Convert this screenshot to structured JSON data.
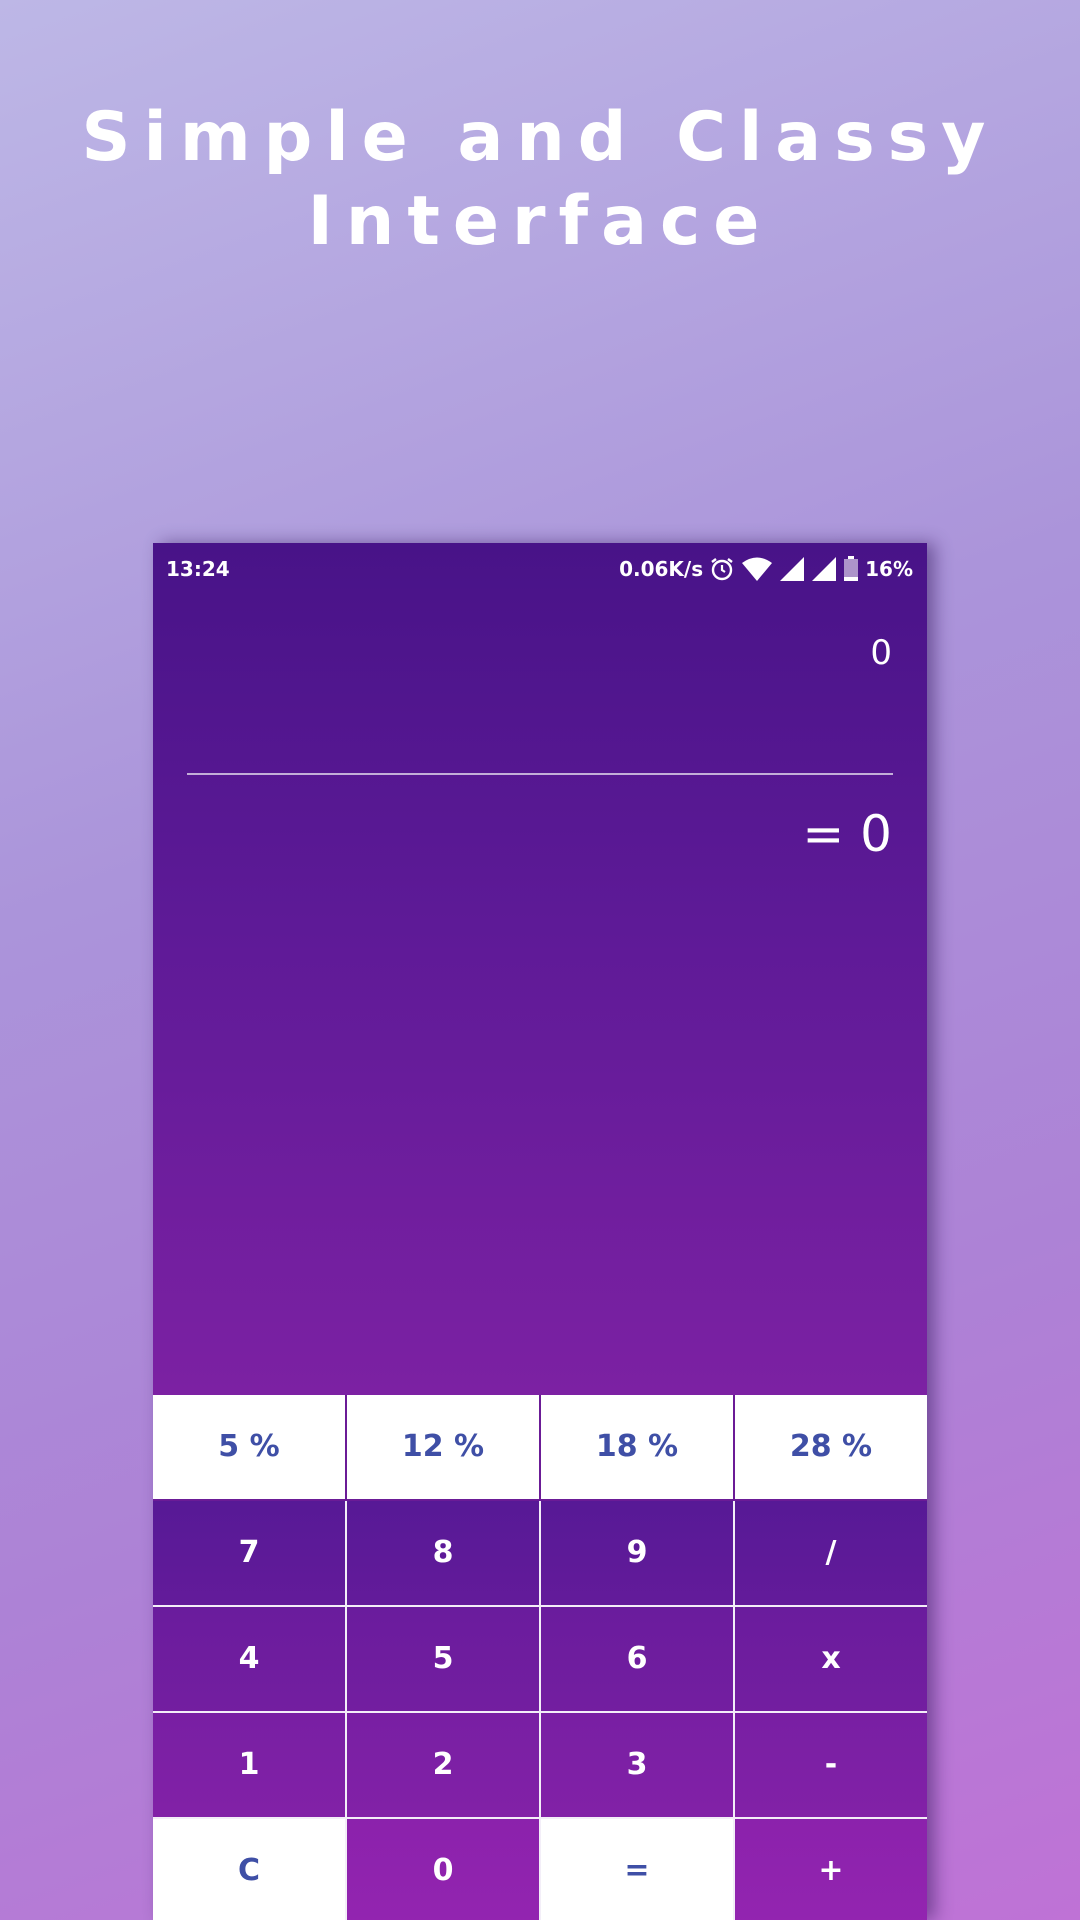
{
  "banner": {
    "line1": "Simple and Classy",
    "line2": "Interface"
  },
  "status_bar": {
    "time": "13:24",
    "net_speed": "0.06K/s",
    "battery": "16%",
    "icons": [
      "alarm-icon",
      "wifi-icon",
      "signal-icon",
      "signal-icon",
      "battery-icon"
    ]
  },
  "display": {
    "expression": "0",
    "result": "= 0"
  },
  "keypad": {
    "percent_row": [
      "5 %",
      "12 %",
      "18 %",
      "28 %"
    ],
    "row1": [
      "7",
      "8",
      "9",
      "/"
    ],
    "row2": [
      "4",
      "5",
      "6",
      "x"
    ],
    "row3": [
      "1",
      "2",
      "3",
      "-"
    ],
    "row4": [
      "C",
      "0",
      "=",
      "+"
    ]
  },
  "colors": {
    "accent_text": "#3f4fa6",
    "display_top": "#481388",
    "display_bottom": "#7c21a3",
    "key_purple": "#8c22ad"
  }
}
